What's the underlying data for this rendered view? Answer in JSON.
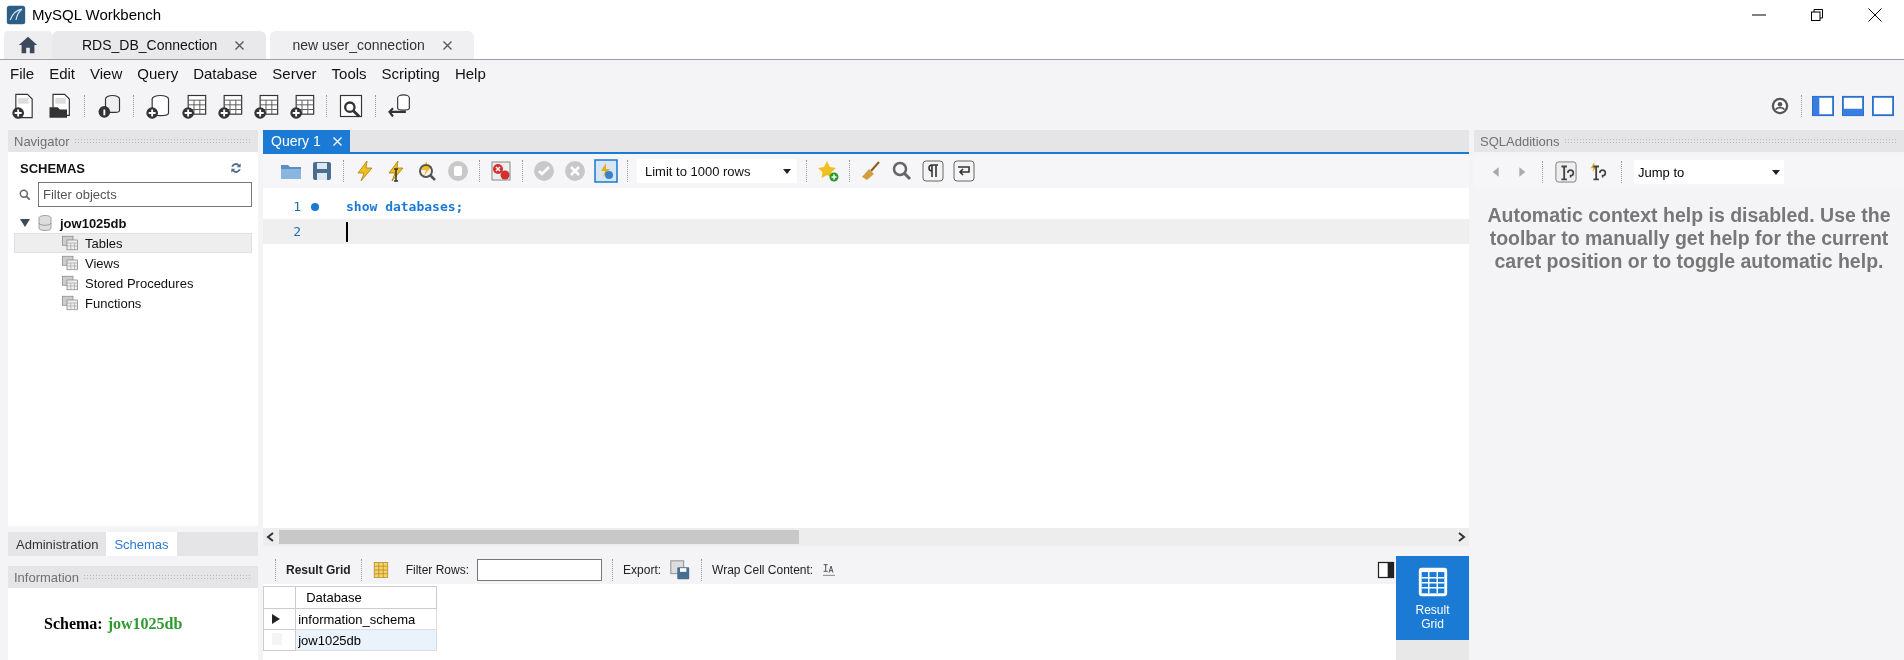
{
  "window": {
    "title": "MySQL Workbench"
  },
  "connection_tabs": [
    {
      "label": "RDS_DB_Connection",
      "selected": false
    },
    {
      "label": "new user_connection",
      "selected": true
    }
  ],
  "menu": [
    "File",
    "Edit",
    "View",
    "Query",
    "Database",
    "Server",
    "Tools",
    "Scripting",
    "Help"
  ],
  "navigator": {
    "title": "Navigator",
    "section": "SCHEMAS",
    "filter": {
      "placeholder": "Filter objects"
    },
    "tree": [
      {
        "label": "jow1025db",
        "expanded": true,
        "children": [
          {
            "label": "Tables",
            "selected": true
          },
          {
            "label": "Views",
            "selected": false
          },
          {
            "label": "Stored Procedures",
            "selected": false
          },
          {
            "label": "Functions",
            "selected": false
          }
        ]
      }
    ],
    "bottom_tabs": [
      {
        "label": "Administration",
        "selected": false
      },
      {
        "label": "Schemas",
        "selected": true
      }
    ]
  },
  "information": {
    "title": "Information",
    "schema_label": "Schema:",
    "schema_value": "jow1025db"
  },
  "query_tabs": [
    {
      "label": "Query 1",
      "selected": true
    }
  ],
  "query_toolbar": {
    "limit": "Limit to 1000 rows"
  },
  "editor": {
    "lines": [
      {
        "number": "1",
        "code": "show databases;",
        "marker": true,
        "current": false
      },
      {
        "number": "2",
        "marker": false,
        "current": true
      }
    ]
  },
  "result_toolbar": {
    "result_grid": "Result Grid",
    "filter_label": "Filter Rows:",
    "export_label": "Export:",
    "wrap_label": "Wrap Cell Content:"
  },
  "result_table": {
    "columns": [
      "Database"
    ],
    "rows": [
      {
        "cells": [
          "information_schema"
        ],
        "current": true,
        "selected": false
      },
      {
        "cells": [
          "jow1025db"
        ],
        "current": false,
        "selected": true
      }
    ]
  },
  "result_side_button": {
    "label": "Result Grid",
    "selected": true
  },
  "sql_additions": {
    "title": "SQLAdditions",
    "jump_to": "Jump to",
    "help_text": "Automatic context help is disabled. Use the toolbar to manually get help for the current caret position or to toggle automatic help."
  }
}
